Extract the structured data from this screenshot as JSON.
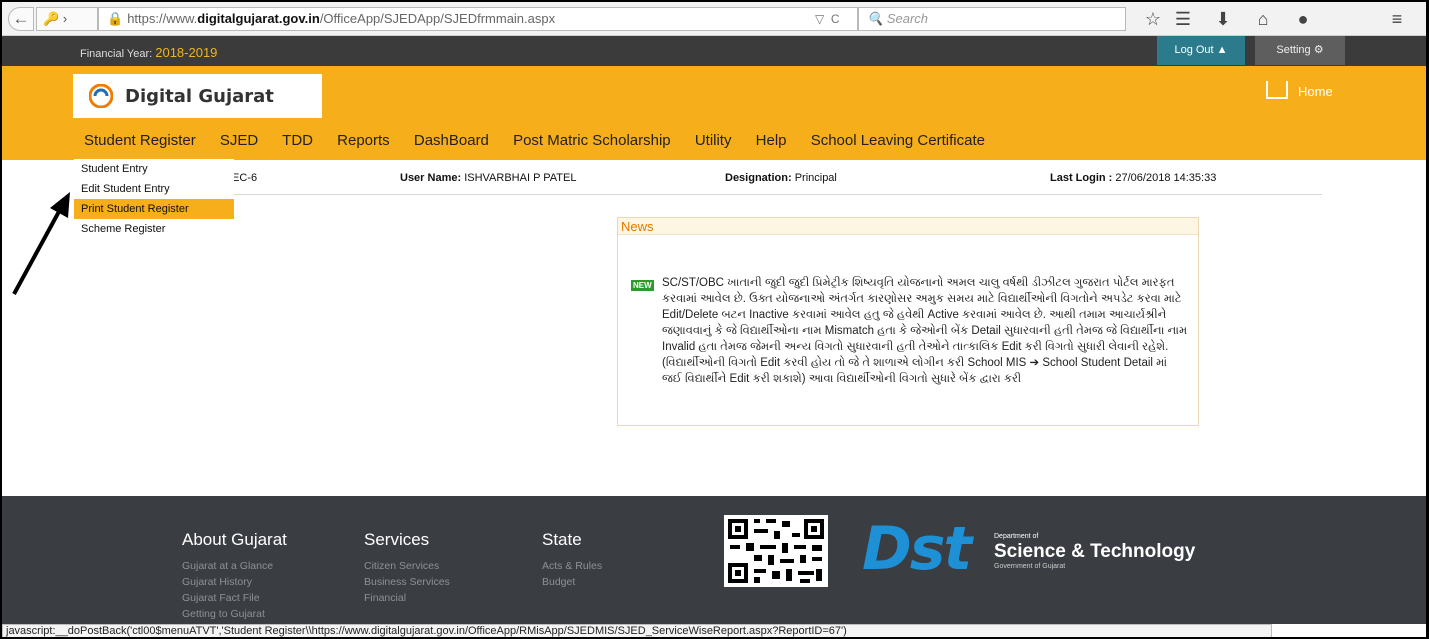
{
  "browser": {
    "url_prefix": "https://www.",
    "url_domain": "digitalgujarat.gov.in",
    "url_path": "/OfficeApp/SJEDApp/SJEDfrmmain.aspx",
    "search_placeholder": "Search"
  },
  "header": {
    "financial_year_label": "Financial Year:",
    "financial_year_value": "2018-2019",
    "logout_label": "Log Out",
    "setting_label": "Setting",
    "logo_text": "Digital Gujarat",
    "home_label": "Home"
  },
  "menu": {
    "items": [
      "Student Register",
      "SJED",
      "TDD",
      "Reports",
      "DashBoard",
      "Post Matric Scholarship",
      "Utility",
      "Help",
      "School Leaving Certificate"
    ]
  },
  "dropdown": {
    "items": [
      "Student Entry",
      "Edit Student Entry",
      "Print Student Register",
      "Scheme Register"
    ],
    "active_index": 2
  },
  "info": {
    "school_code_fragment": "EC-6",
    "user_label": "User Name:",
    "user_value": "ISHVARBHAI P PATEL",
    "designation_label": "Designation:",
    "designation_value": "Principal",
    "last_login_label": "Last Login :",
    "last_login_value": "27/06/2018 14:35:33"
  },
  "news": {
    "title": "News",
    "badge": "NEW",
    "body": "SC/ST/OBC ખાતાની જુદી જુદી પ્રિમેટ્રીક શિષ્યવૃતિ યોજનાનો અમલ ચાલુ વર્ષથી ડીઝીટલ ગુજરાત પોર્ટલ મારફત કરવામાં આવેલ છે. ઉક્ત યોજનાઓ અંતર્ગત કારણોસર અમુક સમય માટે વિદ્યાર્થીઓની વિગતોને અપડેટ કરવા માટે Edit/Delete બટન Inactive કરવામાં આવેલ હતુ જે હવેથી Active કરવામાં આવેલ છે. આથી તમામ આચાર્યશ્રીને જણાવવાનું કે જે વિદ્યાર્થીઓના નામ Mismatch હતા કે જેઓની બેંક Detail સુધારવાની હતી તેમજ જે વિદ્યાર્થીના નામ Invalid હતા તેમજ જેમની અન્ય વિગતો સુધારવાની હતી તેઓને તાત્કાલિક Edit કરી વિગતો સુધારી લેવાની રહેશે. (વિદ્યાર્થીઓની વિગતો Edit કરવી હોય તો જે તે શાળાએ લોગીન કરી School MIS ➔ School Student Detail માં જઈ વિદ્યાર્થીને Edit કરી શકાશે) આવા વિદ્યાર્થીઓની વિગતો સુધારે બેંક દ્વારા કરી"
  },
  "footer": {
    "about": {
      "title": "About Gujarat",
      "links": [
        "Gujarat at a Glance",
        "Gujarat History",
        "Gujarat Fact File",
        "Getting to Gujarat"
      ]
    },
    "services": {
      "title": "Services",
      "links": [
        "Citizen Services",
        "Business Services",
        "Financial"
      ]
    },
    "state": {
      "title": "State",
      "links": [
        "Acts & Rules",
        "Budget"
      ]
    },
    "dst": {
      "logo": "Dst",
      "dept_of": "Department of",
      "title": "Science & Technology",
      "govt": "Government of Gujarat"
    }
  },
  "status_bar": "javascript:__doPostBack('ctl00$menuATVT','Student Register\\\\https://www.digitalgujarat.gov.in/OfficeApp/RMisApp/SJEDMIS/SJED_ServiceWiseReport.aspx?ReportID=67')",
  "colors": {
    "accent": "#f7ae1b",
    "dark": "#3b3b3b",
    "footer": "#3a3d42",
    "dst_blue": "#1e90d6"
  }
}
